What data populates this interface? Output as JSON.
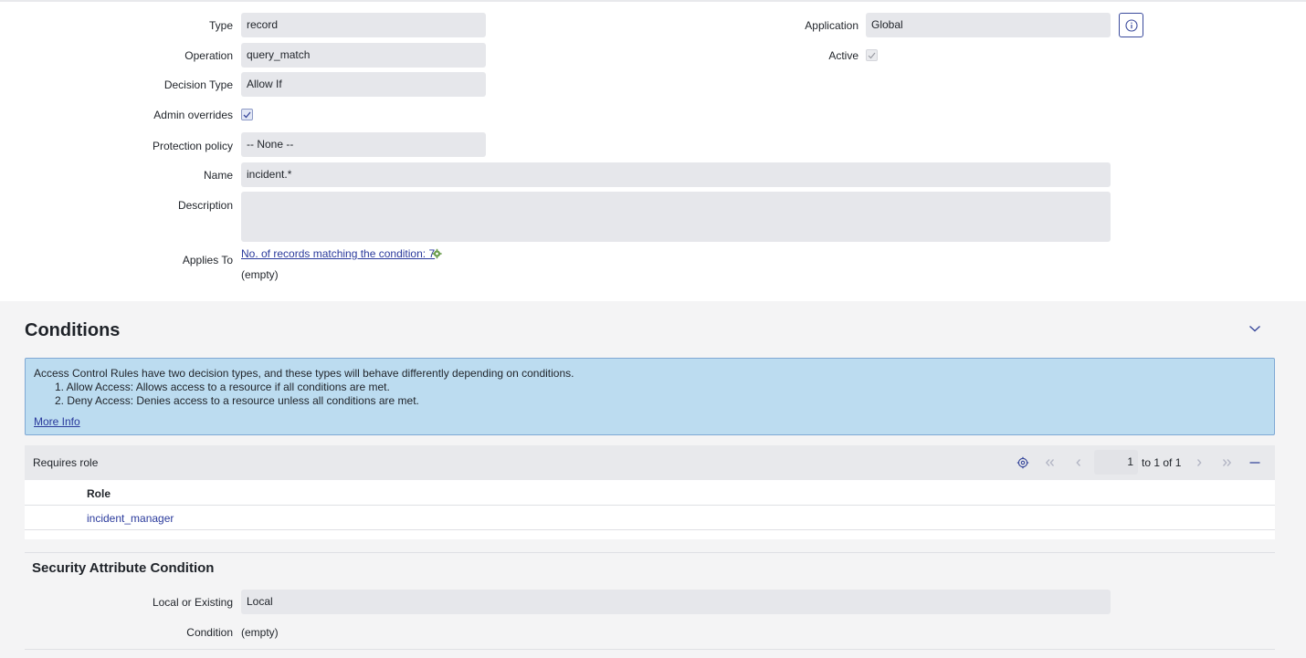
{
  "form": {
    "type": {
      "label": "Type",
      "value": "record"
    },
    "operation": {
      "label": "Operation",
      "value": "query_match"
    },
    "decision_type": {
      "label": "Decision Type",
      "value": "Allow If"
    },
    "admin_overrides": {
      "label": "Admin overrides",
      "checked": true
    },
    "protection_policy": {
      "label": "Protection policy",
      "value": "-- None --"
    },
    "name": {
      "label": "Name",
      "value": "incident.*"
    },
    "description": {
      "label": "Description",
      "value": ""
    },
    "applies_to": {
      "label": "Applies To",
      "link": "No. of records matching the condition: 7",
      "value": "(empty)"
    },
    "application": {
      "label": "Application",
      "value": "Global"
    },
    "active": {
      "label": "Active",
      "checked": true
    }
  },
  "conditions": {
    "title": "Conditions",
    "notice": {
      "intro": "Access Control Rules have two decision types, and these types will behave differently depending on conditions.",
      "item1": "1. Allow Access: Allows access to a resource if all conditions are met.",
      "item2": "2. Deny Access: Denies access to a resource unless all conditions are met.",
      "more_info": "More Info"
    },
    "requires_role": {
      "title": "Requires role",
      "page_current": "1",
      "page_of": "to 1 of 1",
      "columns": [
        "Role"
      ],
      "rows": [
        {
          "role": "incident_manager"
        }
      ]
    },
    "security_attribute": {
      "title": "Security Attribute Condition",
      "local_or_existing": {
        "label": "Local or Existing",
        "value": "Local"
      },
      "condition": {
        "label": "Condition",
        "value": "(empty)"
      }
    }
  },
  "colors": {
    "link": "#2a3a9c",
    "field_bg": "#e6e7eb",
    "notice_bg": "#bcdcf0",
    "notice_border": "#7fa8d4",
    "section_bg": "#f4f4f5"
  },
  "icons": [
    "info-icon",
    "check-icon",
    "gear-green-icon",
    "chevron-down-icon",
    "settings-icon",
    "first-page-icon",
    "prev-page-icon",
    "next-page-icon",
    "last-page-icon",
    "collapse-icon"
  ]
}
